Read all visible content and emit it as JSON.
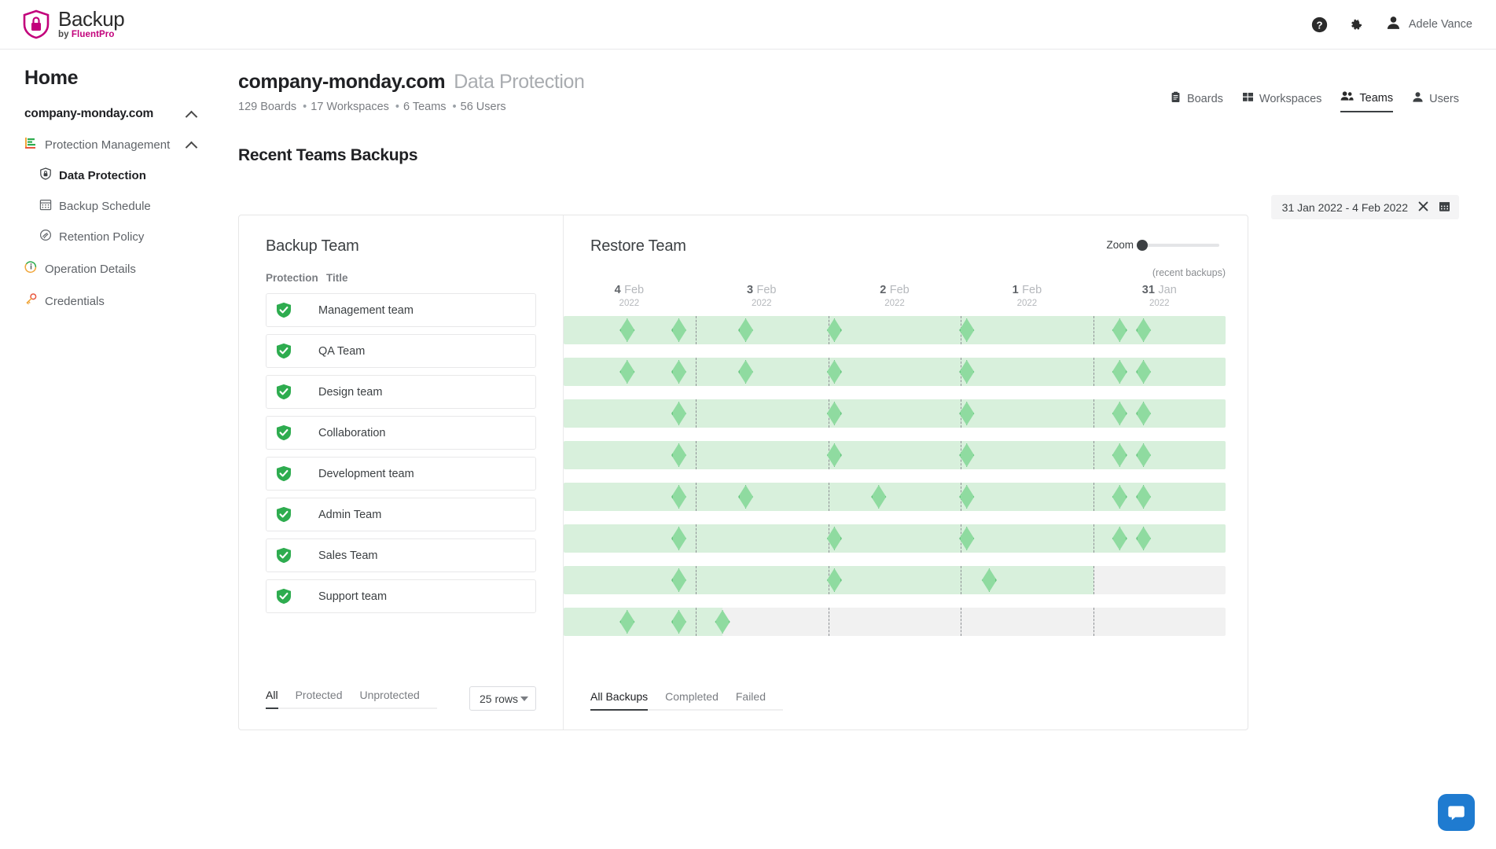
{
  "topbar": {
    "brand_title": "Backup",
    "brand_by": "by ",
    "brand_vendor": "FluentPro",
    "help_icon": "help-circle-icon",
    "settings_icon": "gear-icon",
    "avatar_icon": "person-icon",
    "user_name": "Adele Vance"
  },
  "sidebar": {
    "home_label": "Home",
    "root_label": "company-monday.com",
    "root_chevron": "chevron-up-icon",
    "group": {
      "label": "Protection Management",
      "icon": "protection-management-icon",
      "chevron": "chevron-up-icon"
    },
    "items": [
      {
        "label": "Data Protection",
        "icon": "shield-lock-icon",
        "active": true
      },
      {
        "label": "Backup Schedule",
        "icon": "calendar-icon",
        "active": false
      },
      {
        "label": "Retention Policy",
        "icon": "retention-icon",
        "active": false
      }
    ],
    "level1": [
      {
        "label": "Operation Details",
        "icon": "info-circle-icon"
      },
      {
        "label": "Credentials",
        "icon": "key-icon"
      }
    ]
  },
  "header": {
    "title": "company-monday.com",
    "subtitle": "Data Protection",
    "stats": [
      {
        "value": "129 Boards"
      },
      {
        "value": "17 Workspaces"
      },
      {
        "value": "6 Teams"
      },
      {
        "value": "56 Users"
      }
    ],
    "tabs": [
      {
        "label": "Boards",
        "icon": "clipboard-icon",
        "active": false
      },
      {
        "label": "Workspaces",
        "icon": "grid-icon",
        "active": false
      },
      {
        "label": "Teams",
        "icon": "people-icon",
        "active": true
      },
      {
        "label": "Users",
        "icon": "person-icon",
        "active": false
      }
    ]
  },
  "section": {
    "title": "Recent Teams Backups",
    "date_range": "31 Jan 2022 - 4 Feb 2022",
    "clear_icon": "close-icon",
    "calendar_icon": "calendar-icon"
  },
  "backup_panel": {
    "title": "Backup Team",
    "columns": {
      "protection": "Protection",
      "title": "Title"
    },
    "teams": [
      {
        "name": "Management team",
        "status": "protected",
        "status_icon": "shield-check-icon"
      },
      {
        "name": "QA Team",
        "status": "protected",
        "status_icon": "shield-check-icon"
      },
      {
        "name": "Design team",
        "status": "protected",
        "status_icon": "shield-check-icon"
      },
      {
        "name": "Collaboration",
        "status": "protected",
        "status_icon": "shield-check-icon"
      },
      {
        "name": "Development team",
        "status": "protected",
        "status_icon": "shield-check-icon"
      },
      {
        "name": "Admin Team",
        "status": "protected",
        "status_icon": "shield-check-icon"
      },
      {
        "name": "Sales Team",
        "status": "protected",
        "status_icon": "shield-check-icon"
      },
      {
        "name": "Support team",
        "status": "protected",
        "status_icon": "shield-check-icon"
      }
    ],
    "filters": [
      {
        "label": "All",
        "active": true
      },
      {
        "label": "Protected",
        "active": false
      },
      {
        "label": "Unprotected",
        "active": false
      }
    ],
    "rows_select": {
      "value": "25 rows",
      "caret_icon": "chevron-down-icon"
    }
  },
  "restore_panel": {
    "title": "Restore Team",
    "zoom_label": "Zoom",
    "zoom_value": 0,
    "recent_note": "(recent backups)",
    "axis": [
      {
        "day": "4",
        "month": "Feb",
        "year": "2022",
        "pos": 9.9
      },
      {
        "day": "3",
        "month": "Feb",
        "year": "2022",
        "pos": 29.9
      },
      {
        "day": "2",
        "month": "Feb",
        "year": "2022",
        "pos": 50.0
      },
      {
        "day": "1",
        "month": "Feb",
        "year": "2022",
        "pos": 70.0
      },
      {
        "day": "31",
        "month": "Jan",
        "year": "2022",
        "pos": 90.0
      }
    ],
    "separators": [
      19.9,
      40.0,
      60.0,
      80.0
    ],
    "rows": [
      {
        "fill": 100,
        "markers": [
          9.6,
          17.4,
          27.5,
          40.9,
          60.9,
          84.0,
          87.6
        ]
      },
      {
        "fill": 100,
        "markers": [
          9.6,
          17.4,
          27.5,
          40.9,
          60.9,
          84.0,
          87.6
        ]
      },
      {
        "fill": 100,
        "markers": [
          17.4,
          40.9,
          60.9,
          84.0,
          87.6
        ]
      },
      {
        "fill": 100,
        "markers": [
          17.4,
          40.9,
          60.9,
          84.0,
          87.6
        ]
      },
      {
        "fill": 100,
        "markers": [
          17.4,
          27.5,
          47.6,
          60.9,
          84.0,
          87.6
        ]
      },
      {
        "fill": 100,
        "markers": [
          17.4,
          40.9,
          60.9,
          84.0,
          87.6
        ]
      },
      {
        "fill": 80.0,
        "markers": [
          17.4,
          40.9,
          64.3
        ]
      },
      {
        "fill": 24.0,
        "markers": [
          9.6,
          17.4,
          24.0
        ]
      }
    ],
    "tabs": [
      {
        "label": "All Backups",
        "active": true
      },
      {
        "label": "Completed",
        "active": false
      },
      {
        "label": "Failed",
        "active": false
      }
    ]
  },
  "chat": {
    "icon": "chat-bubble-icon",
    "color": "#1f7bd0"
  },
  "colors": {
    "brand": "#c2007b",
    "protected": "#2eac4f",
    "timeline_fill": "#d8f0dc",
    "timeline_empty": "#f1f1f1",
    "marker": "#8fdba0"
  }
}
